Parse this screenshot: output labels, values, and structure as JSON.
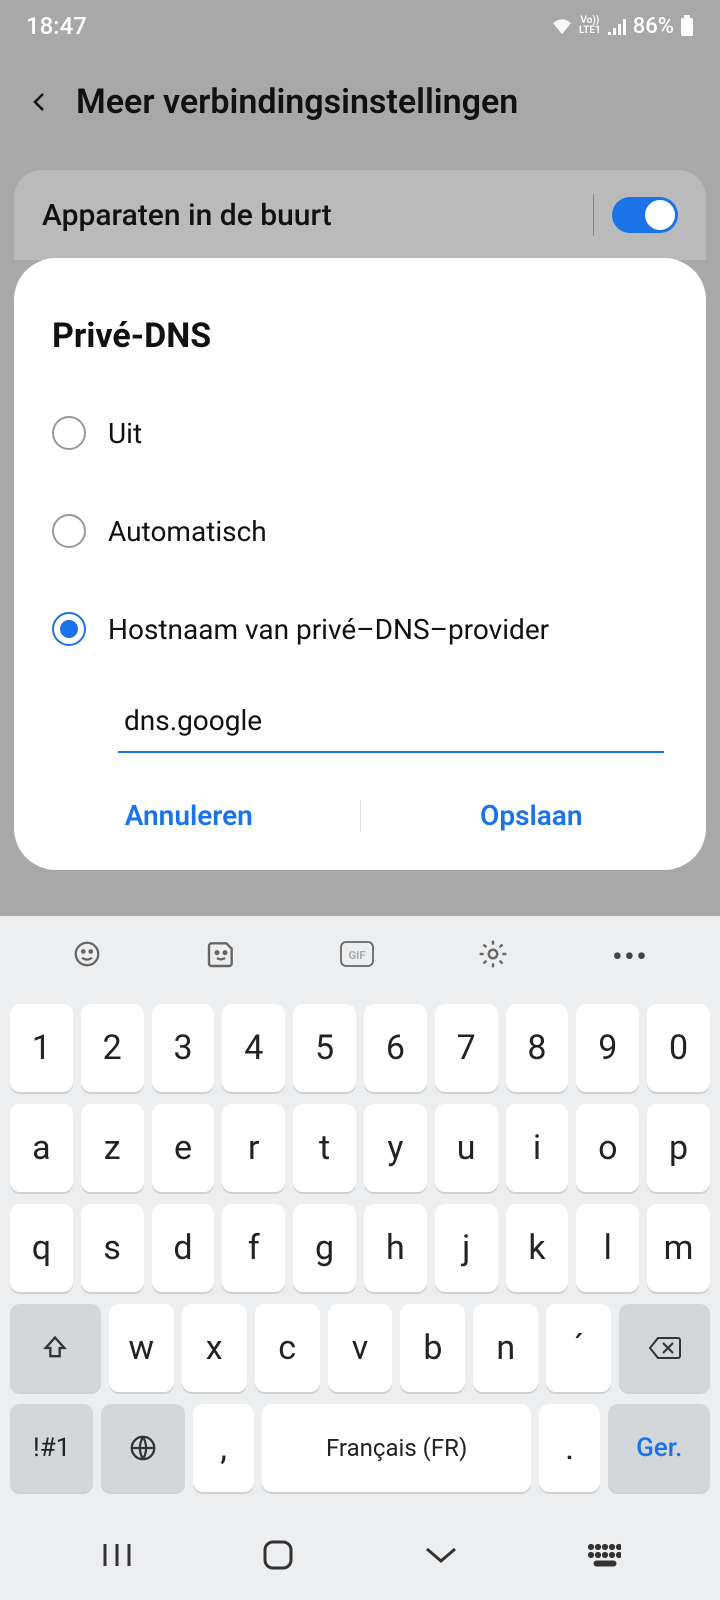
{
  "status": {
    "time": "18:47",
    "lte": "Vo))\nLTE1",
    "battery": "86%"
  },
  "header": {
    "title": "Meer verbindingsinstellingen"
  },
  "setting": {
    "label": "Apparaten in de buurt",
    "toggled": true
  },
  "dialog": {
    "title": "Privé-DNS",
    "options": [
      {
        "label": "Uit",
        "selected": false
      },
      {
        "label": "Automatisch",
        "selected": false
      },
      {
        "label": "Hostnaam van privé–DNS–provider",
        "selected": true
      }
    ],
    "input_value": "dns.google",
    "cancel": "Annuleren",
    "save": "Opslaan"
  },
  "keyboard": {
    "row1": [
      "1",
      "2",
      "3",
      "4",
      "5",
      "6",
      "7",
      "8",
      "9",
      "0"
    ],
    "row2": [
      "a",
      "z",
      "e",
      "r",
      "t",
      "y",
      "u",
      "i",
      "o",
      "p"
    ],
    "row3": [
      "q",
      "s",
      "d",
      "f",
      "g",
      "h",
      "j",
      "k",
      "l",
      "m"
    ],
    "row4": [
      "w",
      "x",
      "c",
      "v",
      "b",
      "n",
      "´"
    ],
    "sym": "!#1",
    "space": "Français (FR)",
    "comma": ",",
    "period": ".",
    "enter": "Ger."
  }
}
